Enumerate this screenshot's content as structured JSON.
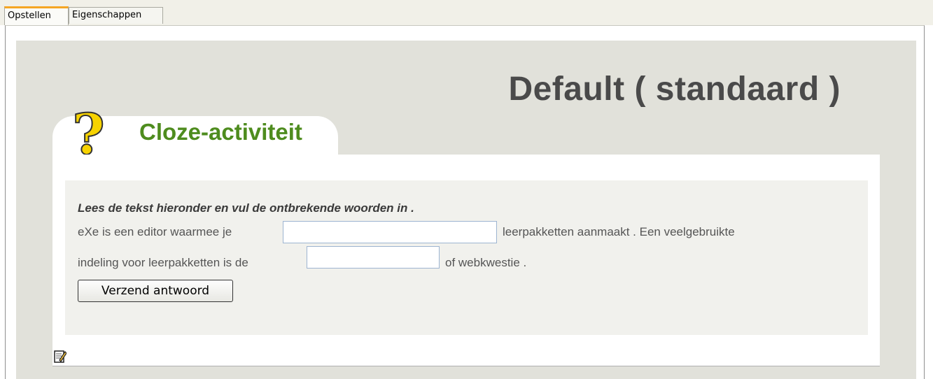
{
  "tabs": [
    {
      "label": "Opstellen",
      "active": true
    },
    {
      "label": "Eigenschappen",
      "active": false
    }
  ],
  "theme_title": "Default ( standaard )",
  "idevice": {
    "icon": "question-mark-icon",
    "title": "Cloze-activiteit",
    "instructions": "Lees de tekst hieronder en vul de ontbrekende woorden in .",
    "line1_before": "eXe is een editor waarmee je",
    "line1_after": "leerpakketten aanmaakt . Een veelgebruikte",
    "line2_before": "indeling voor leerpakketten is de",
    "line2_after": "of webkwestie .",
    "blank1_value": "",
    "blank2_value": "",
    "submit_label": "Verzend antwoord",
    "edit_icon": "edit-icon"
  },
  "colors": {
    "title_green": "#4e8c1e",
    "content_bg": "#e1e1da",
    "active_tab_accent": "#f5a623"
  }
}
